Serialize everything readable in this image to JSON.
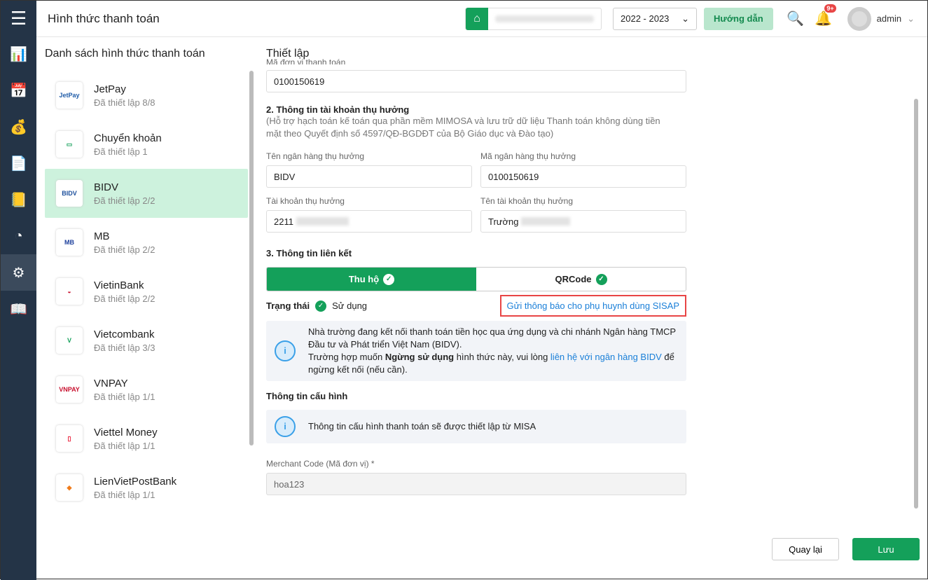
{
  "header": {
    "title": "Hình thức thanh toán",
    "year": "2022 - 2023",
    "guide": "Hướng dẫn",
    "badge": "9+",
    "user": "admin"
  },
  "sidebar": {
    "icons": [
      "chart-icon",
      "calendar-money-icon",
      "hand-money-icon",
      "document-icon",
      "ledger-icon",
      "pie-chart-icon",
      "gear-icon",
      "book-icon"
    ],
    "active": "gear-icon"
  },
  "left": {
    "title": "Danh sách hình thức thanh toán",
    "items": [
      {
        "name": "JetPay",
        "status": "Đã thiết lập 8/8",
        "logo": "JetPay",
        "color": "#1f5ca8"
      },
      {
        "name": "Chuyển khoản",
        "status": "Đã thiết lập 1",
        "logo": "▭",
        "color": "#14a05a"
      },
      {
        "name": "BIDV",
        "status": "Đã thiết lập 2/2",
        "logo": "BIDV",
        "color": "#1c4f9c"
      },
      {
        "name": "MB",
        "status": "Đã thiết lập 2/2",
        "logo": "MB",
        "color": "#1c3f9c"
      },
      {
        "name": "VietinBank",
        "status": "Đã thiết lập 2/2",
        "logo": "◒",
        "color": "#c8102e"
      },
      {
        "name": "Vietcombank",
        "status": "Đã thiết lập 3/3",
        "logo": "V",
        "color": "#14a05a"
      },
      {
        "name": "VNPAY",
        "status": "Đã thiết lập 1/1",
        "logo": "VNPAY",
        "color": "#c8102e"
      },
      {
        "name": "Viettel Money",
        "status": "Đã thiết lập 1/1",
        "logo": "▯",
        "color": "#e8112d"
      },
      {
        "name": "LienVietPostBank",
        "status": "Đã thiết lập 1/1",
        "logo": "◆",
        "color": "#f07b1a"
      }
    ],
    "active": "BIDV"
  },
  "main": {
    "title": "Thiết lập",
    "unit_label": "Mã đơn vị thanh toán",
    "unit_value": "0100150619",
    "sec2": "2. Thông tin tài khoản thụ hưởng",
    "sec2_note": "(Hỗ trợ hạch toán kế toán qua phần mềm MIMOSA và lưu trữ dữ liệu Thanh toán không dùng tiền mặt theo Quyết định số 4597/QĐ-BGDĐT của Bộ Giáo dục và Đào tạo)",
    "bank_name_label": "Tên ngân hàng thụ hưởng",
    "bank_name": "BIDV",
    "bank_code_label": "Mã ngân hàng thụ hưởng",
    "bank_code": "0100150619",
    "account_label": "Tài khoản thụ hưởng",
    "account": "2211",
    "account_name_label": "Tên tài khoản thụ hưởng",
    "account_name": "Trường",
    "sec3": "3. Thông tin liên kết",
    "tab1": "Thu hộ",
    "tab2": "QRCode",
    "status_label": "Trạng thái",
    "status": "Sử dụng",
    "sisap_link": "Gửi thông báo cho phụ huynh dùng SISAP",
    "info1_a": "Nhà trường đang kết nối thanh toán tiền học qua ứng dụng và chi nhánh Ngân hàng TMCP Đầu tư và Phát triển Việt Nam (BIDV).",
    "info1_b": "Trường hợp muốn ",
    "info1_bold": "Ngừng sử dụng",
    "info1_c": " hình thức này, vui lòng ",
    "info1_link": "liên hệ với ngân hàng BIDV",
    "info1_d": " để ngừng kết nối (nếu cần).",
    "config_title": "Thông tin cấu hình",
    "config_info": "Thông tin cấu hình thanh toán sẽ được thiết lập từ MISA",
    "merchant_label": "Merchant Code (Mã đơn vị) *",
    "merchant": "hoa123"
  },
  "footer": {
    "back": "Quay lại",
    "save": "Lưu"
  }
}
